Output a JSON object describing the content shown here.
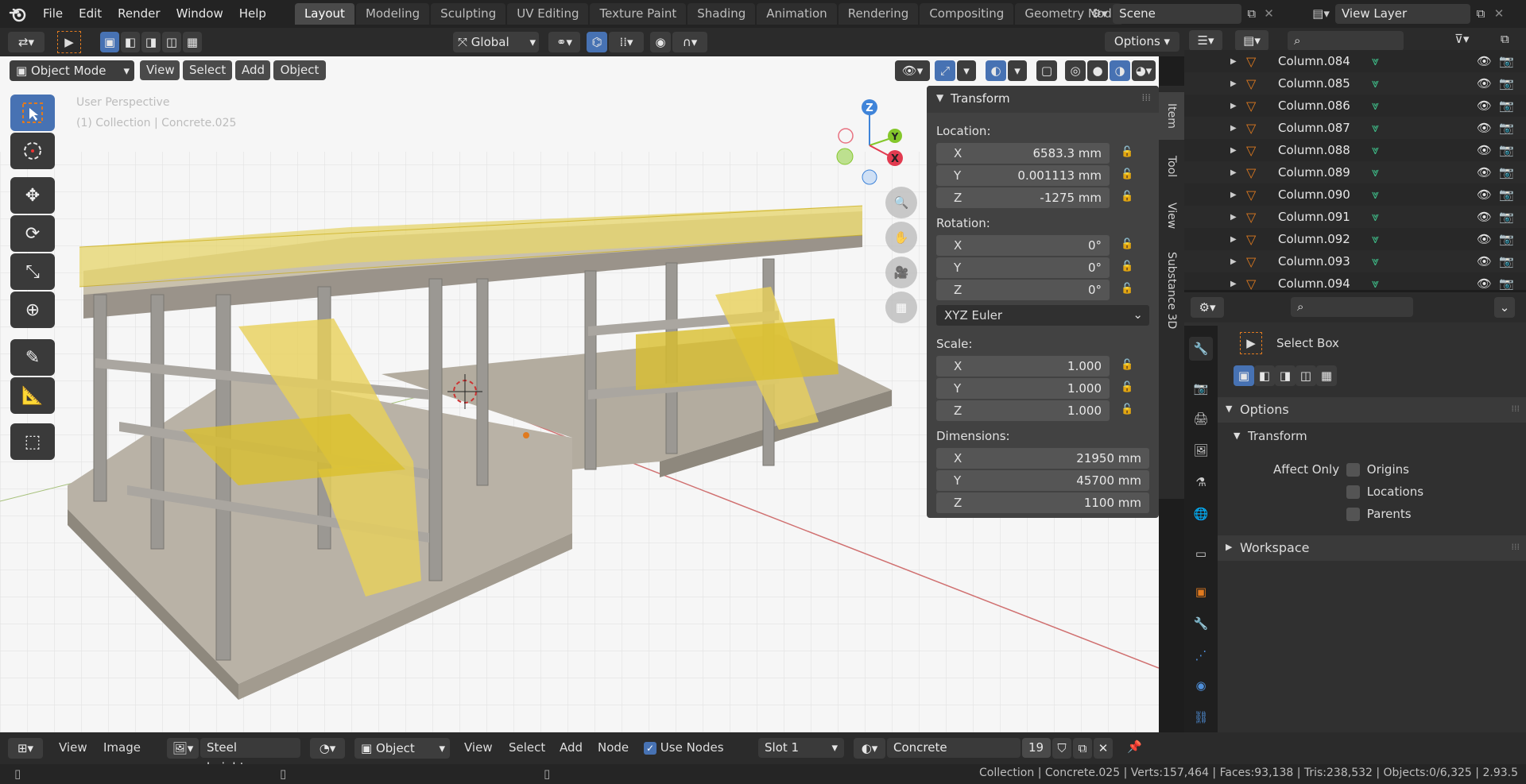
{
  "menus": [
    "File",
    "Edit",
    "Render",
    "Window",
    "Help"
  ],
  "workspaces": [
    {
      "label": "Layout",
      "active": true
    },
    {
      "label": "Modeling"
    },
    {
      "label": "Sculpting"
    },
    {
      "label": "UV Editing"
    },
    {
      "label": "Texture Paint"
    },
    {
      "label": "Shading"
    },
    {
      "label": "Animation"
    },
    {
      "label": "Rendering"
    },
    {
      "label": "Compositing"
    },
    {
      "label": "Geometry Nod"
    }
  ],
  "scene": "Scene",
  "view_layer": "View Layer",
  "tool_header": {
    "orientation": "Global",
    "options": "Options"
  },
  "view_header": {
    "mode": "Object Mode",
    "view": "View",
    "select": "Select",
    "add": "Add",
    "object": "Object"
  },
  "viewport": {
    "perspective": "User Perspective",
    "collection": "(1) Collection | Concrete.025"
  },
  "transform": {
    "title": "Transform",
    "location_label": "Location:",
    "location": [
      {
        "axis": "X",
        "value": "6583.3 mm"
      },
      {
        "axis": "Y",
        "value": "0.001113 mm"
      },
      {
        "axis": "Z",
        "value": "-1275 mm"
      }
    ],
    "rotation_label": "Rotation:",
    "rotation": [
      {
        "axis": "X",
        "value": "0°"
      },
      {
        "axis": "Y",
        "value": "0°"
      },
      {
        "axis": "Z",
        "value": "0°"
      }
    ],
    "rotation_mode": "XYZ Euler",
    "scale_label": "Scale:",
    "scale": [
      {
        "axis": "X",
        "value": "1.000"
      },
      {
        "axis": "Y",
        "value": "1.000"
      },
      {
        "axis": "Z",
        "value": "1.000"
      }
    ],
    "dimensions_label": "Dimensions:",
    "dimensions": [
      {
        "axis": "X",
        "value": "21950 mm"
      },
      {
        "axis": "Y",
        "value": "45700 mm"
      },
      {
        "axis": "Z",
        "value": "1100 mm"
      }
    ]
  },
  "side_tabs": [
    "Item",
    "Tool",
    "View",
    "Substance 3D"
  ],
  "outliner": {
    "items": [
      "Column.084",
      "Column.085",
      "Column.086",
      "Column.087",
      "Column.088",
      "Column.089",
      "Column.090",
      "Column.091",
      "Column.092",
      "Column.093",
      "Column.094"
    ]
  },
  "properties": {
    "tool_name": "Select Box",
    "options": "Options",
    "transform": "Transform",
    "affect_only": "Affect Only",
    "origins": "Origins",
    "locations": "Locations",
    "parents": "Parents",
    "workspace": "Workspace"
  },
  "bottom_header": {
    "view": "View",
    "image": "Image",
    "image_name": "Steel height.png",
    "object": "Object",
    "view2": "View",
    "select": "Select",
    "add": "Add",
    "node": "Node",
    "use_nodes": "Use Nodes",
    "slot": "Slot 1",
    "material": "Concrete",
    "users": "19"
  },
  "status": {
    "text": "Collection | Concrete.025 | Verts:157,464 | Faces:93,138 | Tris:238,532 | Objects:0/6,325 | 2.93.5"
  },
  "gizmo": {
    "z": "Z",
    "y": "Y",
    "x": "X"
  },
  "colors": {
    "accent": "#4772b3",
    "x_axis": "#e23b50",
    "y_axis": "#84c72b",
    "z_axis": "#3f84d9",
    "object_orange": "#e07a1f",
    "mesh_teal": "#3fbf8a",
    "railing": "#d4b60f"
  }
}
